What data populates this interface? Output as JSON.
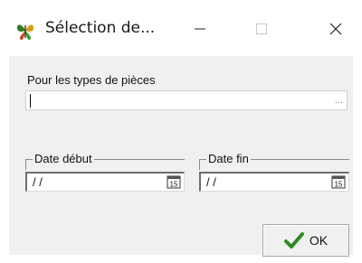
{
  "window": {
    "title": "Sélection de...",
    "icon": "butterfly-app-icon",
    "controls": {
      "minimize": "minimize-icon",
      "maximize": "maximize-icon",
      "close": "close-icon"
    }
  },
  "form": {
    "types_label": "Pour les types de pièces",
    "types_value": "",
    "types_browse": "...",
    "date_start": {
      "label": "Date début",
      "value": "/ /",
      "icon": "calendar-icon",
      "icon_text": "15"
    },
    "date_end": {
      "label": "Date fin",
      "value": "/ /",
      "icon": "calendar-icon",
      "icon_text": "15"
    }
  },
  "buttons": {
    "ok_label": "OK",
    "ok_icon": "checkmark-icon",
    "ok_icon_color": "#2e8b22"
  }
}
